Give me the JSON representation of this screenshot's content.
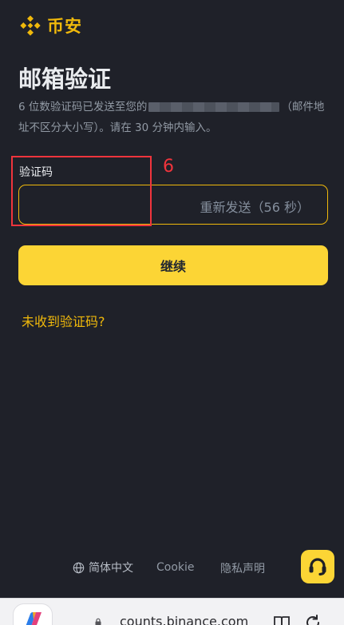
{
  "brand": {
    "name": "币安",
    "color": "#f0b90b"
  },
  "page": {
    "title": "邮箱验证",
    "desc_before": "6 位数验证码已发送至您的",
    "desc_after": "（邮件地址不区分大小写）。请在 30 分钟内输入。"
  },
  "form": {
    "code_label": "验证码",
    "code_value": "",
    "resend_label": "重新发送（56 秒）",
    "continue_label": "继续",
    "no_code_link": "未收到验证码?"
  },
  "annotation": {
    "number": "6",
    "color": "#f0343c"
  },
  "footer": {
    "language": "简体中文",
    "cookie": "Cookie",
    "privacy": "隐私声明"
  },
  "browser": {
    "url": "counts.binance.com"
  },
  "icons": {
    "logo": "binance-logo-icon",
    "globe": "globe-icon",
    "support": "headset-icon",
    "lock": "lock-icon",
    "reader": "book-icon",
    "reload": "reload-icon",
    "copilot": "copilot-icon"
  },
  "colors": {
    "accent": "#fcd535",
    "background": "#1f2129",
    "input_border": "#f0b90b"
  }
}
